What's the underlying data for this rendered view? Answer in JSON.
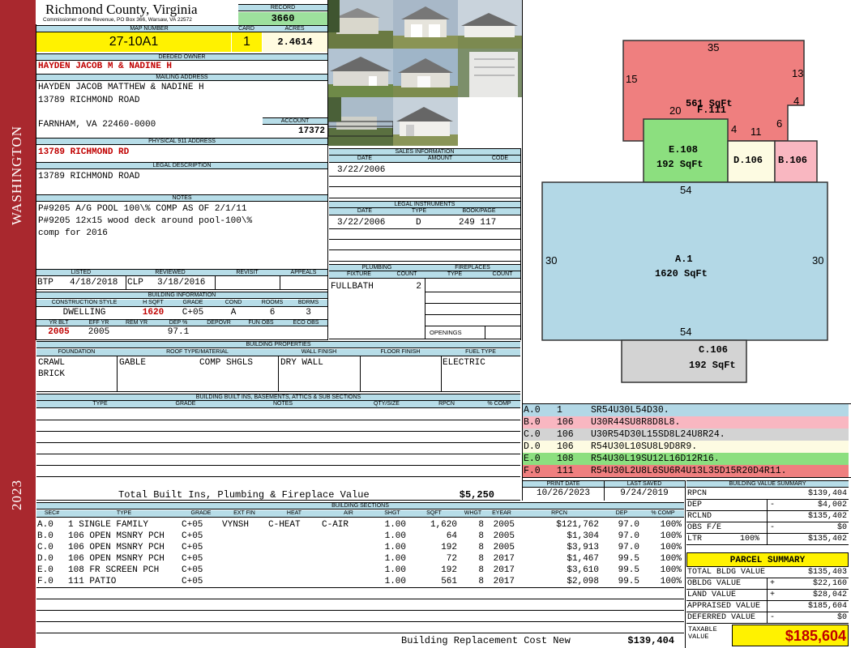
{
  "sidebar": {
    "district": "WASHINGTON",
    "year": "2023"
  },
  "header": {
    "county": "Richmond County, Virginia",
    "commissioner": "Commissioner of the Revenue, PO Box 366, Warsaw, VA 22572",
    "record_label": "RECORD",
    "record": "3660",
    "map_number_label": "MAP NUMBER",
    "map_number": "27-10A1",
    "card_label": "CARD",
    "card": "1",
    "acres_label": "ACRES",
    "acres": "2.4614"
  },
  "owner": {
    "deeded_label": "DEEDED OWNER",
    "deeded": "HAYDEN JACOB M & NADINE H",
    "mailing_label": "MAILING ADDRESS",
    "mailing_line1": "HAYDEN JACOB MATTHEW & NADINE H",
    "mailing_line2": "13789 RICHMOND ROAD",
    "mailing_line3": "FARNHAM, VA 22460-0000",
    "account_label": "ACCOUNT",
    "account": "17372",
    "physical_label": "PHYSICAL 911 ADDRESS",
    "physical": "13789 RICHMOND RD",
    "legal_label": "LEGAL DESCRIPTION",
    "legal": "13789 RICHMOND ROAD",
    "notes_label": "NOTES",
    "notes": [
      "P#9205 A/G POOL 100\\% COMP AS OF 2/1/11",
      "P#9205 12x15 wood deck around pool-100\\%",
      "comp for 2016"
    ]
  },
  "status": {
    "listed_label": "LISTED",
    "reviewed_label": "REVIEWED",
    "revisit_label": "REVISIT",
    "appeals_label": "APPEALS",
    "listed_by": "BTP",
    "listed_date": "4/18/2018",
    "reviewed_by": "CLP",
    "reviewed_date": "3/18/2016"
  },
  "building_info": {
    "title": "BUILDING INFORMATION",
    "h": [
      "CONSTRUCTION STYLE",
      "H SQFT",
      "GRADE",
      "COND",
      "ROOMS",
      "BDRMS"
    ],
    "style": "DWELLING",
    "hsqft": "1620",
    "grade": "C+05",
    "cond": "A",
    "rooms": "6",
    "bdrms": "3",
    "h2": [
      "YR BLT",
      "EFF YR",
      "REM YR",
      "DEP %",
      "DEPOVR",
      "FUN OBS",
      "ECO OBS"
    ],
    "yr_blt": "2005",
    "eff_yr": "2005",
    "dep": "97.1"
  },
  "sales": {
    "title": "SALES INFORMATION",
    "h": [
      "DATE",
      "AMOUNT",
      "CODE"
    ],
    "date": "3/22/2006"
  },
  "legal_inst": {
    "title": "LEGAL INSTRUMENTS",
    "h": [
      "DATE",
      "TYPE",
      "BOOK/PAGE"
    ],
    "date": "3/22/2006",
    "type": "D",
    "bookpage": "249 117"
  },
  "plumbing": {
    "title": "PLUMBING",
    "h": [
      "FIXTURE",
      "COUNT"
    ],
    "fixture": "FULLBATH",
    "count": "2"
  },
  "fireplaces": {
    "title": "FIREPLACES",
    "h": [
      "TYPE",
      "COUNT"
    ],
    "openings": "OPENINGS"
  },
  "properties": {
    "title": "BUILDING PROPERTIES",
    "h": [
      "FOUNDATION",
      "ROOF TYPE/MATERIAL",
      "WALL FINISH",
      "FLOOR FINISH",
      "FUEL TYPE"
    ],
    "foundation1": "CRAWL",
    "foundation2": "BRICK",
    "roof_type": "GABLE",
    "roof_mat": "COMP SHGLS",
    "wall": "DRY WALL",
    "fuel": "ELECTRIC"
  },
  "builtins": {
    "title": "BUILDING BUILT INS, BASEMENTS, ATTICS & SUB SECTIONS",
    "h": [
      "TYPE",
      "GRADE",
      "NOTES",
      "QTY/SIZE",
      "RPCN",
      "% COMP"
    ],
    "total_label": "Total Built Ins, Plumbing & Fireplace Value",
    "total": "$5,250"
  },
  "dates": {
    "print_label": "PRINT DATE",
    "print": "10/26/2023",
    "visit_label": "LAST SAVED",
    "visit": "9/24/2019"
  },
  "sections": {
    "title": "BUILDING SECTIONS",
    "h": [
      "SEC#",
      "TYPE",
      "GRADE",
      "EXT FIN",
      "HEAT",
      "AIR",
      "SHGT",
      "SQFT",
      "WHGT",
      "EYEAR",
      "RPCN",
      "DEP",
      "% COMP"
    ],
    "rows": [
      [
        "A.0",
        "1 SINGLE FAMILY",
        "C+05",
        "VYNSH",
        "C-HEAT",
        "C-AIR",
        "1.00",
        "1,620",
        "8",
        "2005",
        "$121,762",
        "97.0",
        "100%"
      ],
      [
        "B.0",
        "106 OPEN MSNRY PCH",
        "C+05",
        "",
        "",
        "",
        "1.00",
        "64",
        "8",
        "2005",
        "$1,304",
        "97.0",
        "100%"
      ],
      [
        "C.0",
        "106 OPEN MSNRY PCH",
        "C+05",
        "",
        "",
        "",
        "1.00",
        "192",
        "8",
        "2005",
        "$3,913",
        "97.0",
        "100%"
      ],
      [
        "D.0",
        "106 OPEN MSNRY PCH",
        "C+05",
        "",
        "",
        "",
        "1.00",
        "72",
        "8",
        "2017",
        "$1,467",
        "99.5",
        "100%"
      ],
      [
        "E.0",
        "108 FR SCREEN PCH",
        "C+05",
        "",
        "",
        "",
        "1.00",
        "192",
        "8",
        "2017",
        "$3,610",
        "99.5",
        "100%"
      ],
      [
        "F.0",
        "111 PATIO",
        "C+05",
        "",
        "",
        "",
        "1.00",
        "561",
        "8",
        "2017",
        "$2,098",
        "99.5",
        "100%"
      ]
    ],
    "total_label": "Building Replacement Cost New",
    "total": "$139,404"
  },
  "sketch": {
    "F": {
      "label": "F.111",
      "area": "561 SqFt",
      "color": "#ef7f7f"
    },
    "E": {
      "label": "E.108",
      "area": "192 SqFt",
      "color": "#8cdf7f"
    },
    "D": {
      "label": "D.106",
      "color": "#fdfbe2"
    },
    "B": {
      "label": "B.106",
      "color": "#f9b7c1"
    },
    "A": {
      "label": "A.1",
      "area": "1620 SqFt",
      "color": "#b3d8e6"
    },
    "C": {
      "label": "C.106",
      "area": "192 SqFt",
      "color": "#d3d3d3"
    },
    "dims": {
      "f_top": "35",
      "f_left": "15",
      "f_right": "13",
      "f_inner": "20",
      "f_step": "4",
      "f_step2": "6",
      "d_w": "4",
      "d_11": "11",
      "a_top": "54",
      "a_left": "30",
      "a_right": "30",
      "a_bot": "54"
    }
  },
  "legend": [
    {
      "sec": "A.0",
      "code": "1",
      "vec": "SR54U30L54D30.",
      "color": "#b3d8e6"
    },
    {
      "sec": "B.0",
      "code": "106",
      "vec": "U30R44SU8R8D8L8.",
      "color": "#f9b7c1"
    },
    {
      "sec": "C.0",
      "code": "106",
      "vec": "U30R54D30L15SD8L24U8R24.",
      "color": "#d3d3d3"
    },
    {
      "sec": "D.0",
      "code": "106",
      "vec": "R54U30L10SU8L9D8R9.",
      "color": "#fdfbe2"
    },
    {
      "sec": "E.0",
      "code": "108",
      "vec": "R54U30L19SU12L16D12R16.",
      "color": "#8cdf7f"
    },
    {
      "sec": "F.0",
      "code": "111",
      "vec": "R54U30L2U8L6SU6R4U13L35D15R20D4R11.",
      "color": "#ef7f7f"
    }
  ],
  "bvs": {
    "title": "BUILDING VALUE SUMMARY",
    "rpcn_label": "RPCN",
    "rpcn": "$139,404",
    "dep_label": "DEP",
    "dep_sign": "-",
    "dep": "$4,002",
    "rclnd_label": "RCLND",
    "rclnd": "$135,402",
    "obs_label": "OBS F/E",
    "obs_sign": "-",
    "obs": "$0",
    "ltr_label": "LTR",
    "ltr_pct": "100%",
    "ltr": "$135,402"
  },
  "parcel": {
    "title": "PARCEL SUMMARY",
    "tbv_label": "TOTAL BLDG VALUE",
    "tbv": "$135,403",
    "obldg_label": "OBLDG VALUE",
    "obldg_sign": "+",
    "obldg": "$22,160",
    "land_label": "LAND VALUE",
    "land_sign": "+",
    "land": "$28,042",
    "appr_label": "APPRAISED VALUE",
    "appr": "$185,604",
    "def_label": "DEFERRED VALUE",
    "def_sign": "-",
    "def": "$0",
    "taxable_label1": "TAXABLE",
    "taxable_label2": "VALUE",
    "taxable": "$185,604"
  }
}
